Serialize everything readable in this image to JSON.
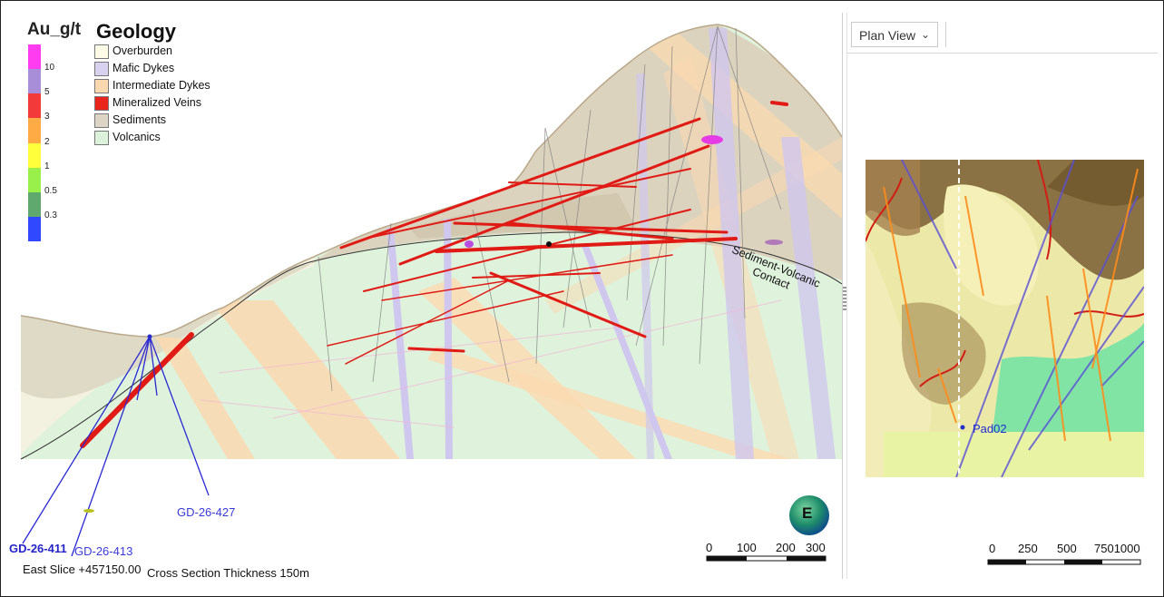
{
  "legend_au": {
    "title": "Au_g/t",
    "ticks": [
      "10",
      "5",
      "3",
      "2",
      "1",
      "0.5",
      "0.3"
    ],
    "colors": [
      "#ff3cf0",
      "#a88ed8",
      "#f23a3a",
      "#ffab45",
      "#ffff3c",
      "#9af04a",
      "#5fa86e",
      "#3048ff"
    ]
  },
  "legend_geology": {
    "title": "Geology",
    "items": [
      {
        "label": "Overburden",
        "color": "#fbfbe8"
      },
      {
        "label": "Mafic Dykes",
        "color": "#d8d2f0"
      },
      {
        "label": "Intermediate Dykes",
        "color": "#fbd9b0"
      },
      {
        "label": "Mineralized Veins",
        "color": "#e8241c"
      },
      {
        "label": "Sediments",
        "color": "#ddd6c6"
      },
      {
        "label": "Volcanics",
        "color": "#daf2da"
      }
    ]
  },
  "section": {
    "contact_label_1": "Sediment-Volcanic",
    "contact_label_2": "Contact",
    "drillholes": [
      "GD-26-427",
      "GD-26-411",
      "GD-26-413"
    ],
    "slice_label": "East Slice +457150.00",
    "thickness_label": "Cross Section Thickness 150m",
    "compass_letter": "E",
    "scale_labels": [
      "0",
      "100",
      "200",
      "300"
    ]
  },
  "plan_view": {
    "dropdown_label": "Plan View",
    "pad_label": "Pad02",
    "scale_labels": [
      "0",
      "250",
      "500",
      "7501000"
    ]
  }
}
